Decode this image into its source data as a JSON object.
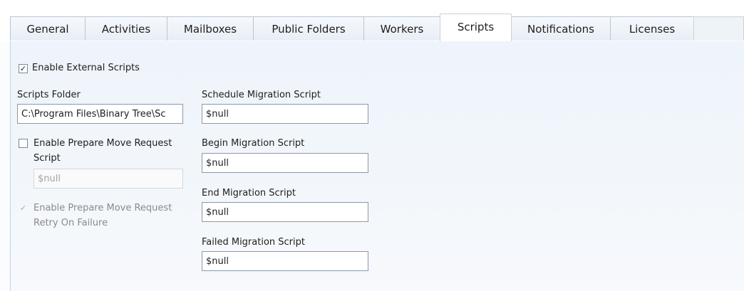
{
  "tabs": [
    {
      "label": "General",
      "active": false
    },
    {
      "label": "Activities",
      "active": false
    },
    {
      "label": "Mailboxes",
      "active": false
    },
    {
      "label": "Public Folders",
      "active": false
    },
    {
      "label": "Workers",
      "active": false
    },
    {
      "label": "Scripts",
      "active": true
    },
    {
      "label": "Notifications",
      "active": false
    },
    {
      "label": "Licenses",
      "active": false
    }
  ],
  "scripts": {
    "enable_external": {
      "label": "Enable External Scripts",
      "checked": true,
      "mark": "✓"
    },
    "scripts_folder": {
      "label": "Scripts Folder",
      "value": "C:\\Program Files\\Binary Tree\\Sc"
    },
    "prepare_move": {
      "label_line1": "Enable Prepare Move Request",
      "label_line2": "Script",
      "checked": false,
      "value": "$null",
      "enabled": false
    },
    "prepare_retry": {
      "label_line1": "Enable Prepare Move Request",
      "label_line2": "Retry On Failure",
      "checked": true,
      "mark": "✓",
      "enabled": false
    },
    "schedule": {
      "label": "Schedule Migration Script",
      "value": "$null"
    },
    "begin": {
      "label": "Begin Migration Script",
      "value": "$null"
    },
    "end": {
      "label": "End Migration Script",
      "value": "$null"
    },
    "failed": {
      "label": "Failed Migration Script",
      "value": "$null"
    }
  },
  "colors": {
    "panel_top": "#eef4fb",
    "tab_border": "#b9c6d3",
    "text": "#1e1e1e",
    "disabled_text": "#8a8a8a"
  }
}
